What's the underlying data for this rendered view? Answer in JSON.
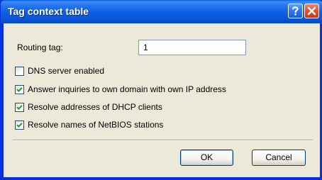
{
  "window": {
    "title": "Tag context table",
    "help_icon": "help-question-icon",
    "close_icon": "close-x-icon"
  },
  "routing_tag": {
    "label": "Routing tag:",
    "value": "1"
  },
  "options": [
    {
      "label": "DNS server enabled",
      "checked": false
    },
    {
      "label": "Answer inquiries to own domain with own IP address",
      "checked": true
    },
    {
      "label": "Resolve addresses of DHCP clients",
      "checked": true
    },
    {
      "label": "Resolve names of NetBIOS stations",
      "checked": true
    }
  ],
  "buttons": {
    "ok": "OK",
    "cancel": "Cancel"
  },
  "colors": {
    "titlebar": "#0a5fe6",
    "dialog_bg": "#ece9d8",
    "close_button": "#e0522a",
    "checkmark": "#21a121"
  }
}
